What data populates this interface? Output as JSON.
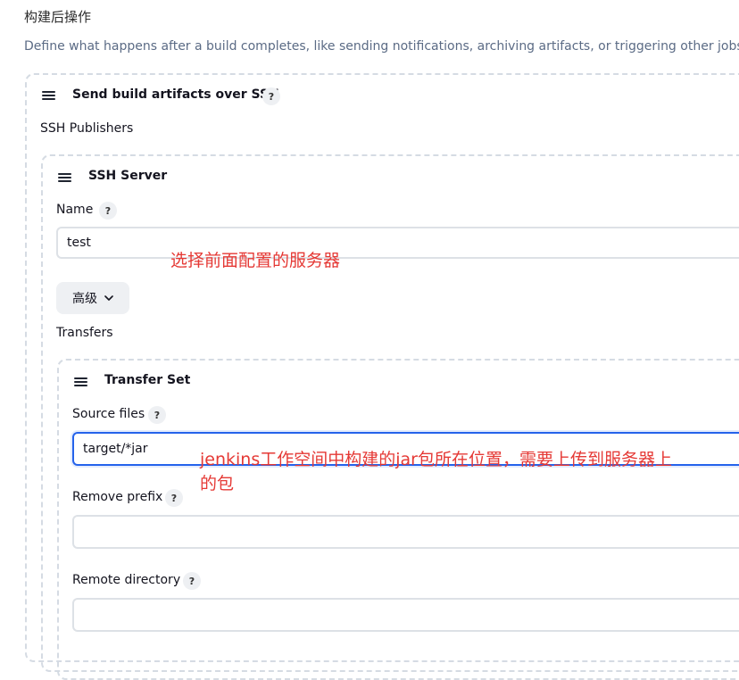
{
  "section": {
    "title": "构建后操作",
    "description": "Define what happens after a build completes, like sending notifications, archiving artifacts, or triggering other jobs."
  },
  "publisher": {
    "title": "Send build artifacts over SSH",
    "help": "?",
    "publishers_label": "SSH Publishers"
  },
  "ssh_server": {
    "title": "SSH Server",
    "name_label": "Name",
    "name_help": "?",
    "name_value": "test",
    "advanced_label": "高级",
    "transfers_label": "Transfers"
  },
  "transfer_set": {
    "title": "Transfer Set",
    "source_label": "Source files",
    "source_help": "?",
    "source_value": "target/*jar",
    "remove_prefix_label": "Remove prefix",
    "remove_prefix_help": "?",
    "remove_prefix_value": "",
    "remote_dir_label": "Remote directory",
    "remote_dir_help": "?",
    "remote_dir_value": ""
  },
  "annotations": {
    "server_note": "选择前面配置的服务器",
    "source_note_line1": "jenkins工作空间中构建的jar包所在位置，需要上传到服务器上",
    "source_note_line2": "的包"
  },
  "colors": {
    "annotation": "#e53935",
    "focus": "#2563eb",
    "dashed_border": "#d5dbe3"
  }
}
